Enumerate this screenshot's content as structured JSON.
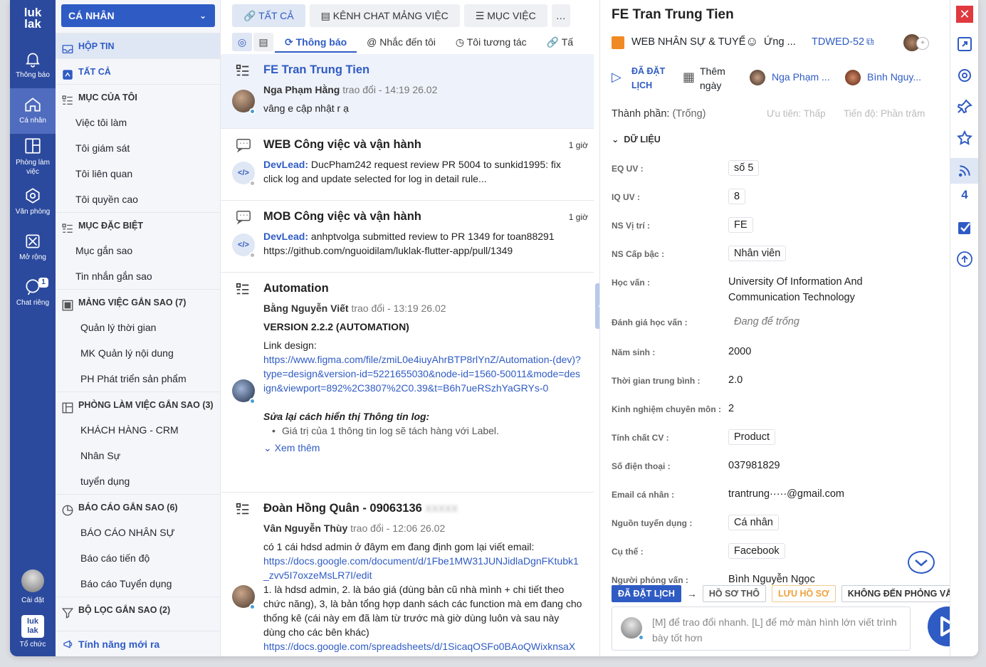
{
  "rail": {
    "logo": "luk lak",
    "items": [
      {
        "label": "Thông báo",
        "icon": "bell-icon"
      },
      {
        "label": "Cá nhân",
        "icon": "home-icon"
      },
      {
        "label": "Phòng làm việc",
        "icon": "layout-icon"
      },
      {
        "label": "Văn phòng",
        "icon": "office-icon"
      },
      {
        "label": "Mở rộng",
        "icon": "extend-icon"
      },
      {
        "label": "Chat riêng",
        "icon": "chat-icon",
        "badge": "1"
      }
    ],
    "settings": "Cài đặt",
    "org": "Tổ chức"
  },
  "sidebar": {
    "header": "CÁ NHÂN",
    "items": [
      {
        "label": "HỘP TIN",
        "type": "head",
        "selected": true
      },
      {
        "label": "TẤT CẢ",
        "type": "head"
      },
      {
        "label": "MỤC CỦA TÔI",
        "type": "head"
      },
      {
        "label": "Việc tôi làm",
        "type": "sub"
      },
      {
        "label": "Tôi giám sát",
        "type": "sub"
      },
      {
        "label": "Tôi liên quan",
        "type": "sub"
      },
      {
        "label": "Tôi quyền cao",
        "type": "sub"
      },
      {
        "label": "MỤC ĐẶC BIỆT",
        "type": "head"
      },
      {
        "label": "Mục gắn sao",
        "type": "sub"
      },
      {
        "label": "Tin nhắn gắn sao",
        "type": "sub"
      },
      {
        "label": "MẢNG VIỆC GẮN SAO (7)",
        "type": "head"
      },
      {
        "label": "Quản lý thời gian",
        "type": "sub2"
      },
      {
        "label": "MK Quản lý nội dung",
        "type": "sub2"
      },
      {
        "label": "PH Phát triển sản phẩm",
        "type": "sub2"
      },
      {
        "label": "PHÒNG LÀM VIỆC GẮN SAO (3)",
        "type": "head"
      },
      {
        "label": "KHÁCH HÀNG - CRM",
        "type": "sub2"
      },
      {
        "label": "Nhân Sự",
        "type": "sub2"
      },
      {
        "label": "tuyển dụng",
        "type": "sub2"
      },
      {
        "label": "BÁO CÁO GẮN SAO (6)",
        "type": "head"
      },
      {
        "label": "BÁO CÁO NHÂN SỰ",
        "type": "sub2"
      },
      {
        "label": "Báo cáo tiến độ",
        "type": "sub2"
      },
      {
        "label": "Báo cáo Tuyển dụng",
        "type": "sub2"
      },
      {
        "label": "BỘ LỌC GẮN SAO (2)",
        "type": "head"
      }
    ],
    "footer": "Tính năng mới ra"
  },
  "center": {
    "top_tabs": [
      {
        "label": "TẤT CẢ",
        "active": true
      },
      {
        "label": "KÊNH CHAT MẢNG VIỆC"
      },
      {
        "label": "MỤC VIỆC"
      },
      {
        "label": "…"
      }
    ],
    "sub_tabs": [
      {
        "label": "Thông báo",
        "active": true
      },
      {
        "label": "@ Nhắc đến tôi"
      },
      {
        "label": "Tôi tương tác"
      },
      {
        "label": "Tấ"
      }
    ],
    "feed": [
      {
        "title": "FE Tran Trung Tien",
        "author": "Nga Phạm Hằng",
        "verb": "trao đổi",
        "time": "14:19 26.02",
        "text": "vâng e cập nhật r ạ"
      },
      {
        "title": "WEB Công việc và vận hành",
        "age": "1 giờ",
        "source": "DevLead:",
        "text": "DucPham242 request review PR 5004 to sunkid1995: fix click log and update selected for log in detail rule..."
      },
      {
        "title": "MOB Công việc và vận hành",
        "age": "1 giờ",
        "source": "DevLead:",
        "text": "anhptvolga submitted review to PR 1349 for toan88291 https://github.com/nguoidilam/luklak-flutter-app/pull/1349"
      },
      {
        "title": "Automation",
        "author": "Bằng Nguyễn Viết",
        "verb": "trao đổi",
        "time": "13:19 26.02",
        "version": "VERSION 2.2.2 (AUTOMATION)",
        "link_label": "Link design:",
        "link": "https://www.figma.com/file/zmiL0e4iuyAhrBTP8rlYnZ/Automation-(dev)?type=design&version-id=5221655030&node-id=1560-50011&mode=design&viewport=892%2C3807%2C0.39&t=B6h7ueRSzhYaGRYs-0",
        "italic": "Sửa lại cách hiển thị Thông tin log:",
        "bullet": "Giá trị của 1 thông tin log sẽ tách hàng với Label.",
        "more": "Xem thêm"
      },
      {
        "title": "Đoàn Hồng Quân - 09063136",
        "title_blur": "xxxxx",
        "author": "Vân Nguyễn Thùy",
        "verb": "trao đổi",
        "time": "12:06 26.02",
        "text1": "có 1 cái hdsd admin ở đâym em đang định gom lại viết email:",
        "link": "https://docs.google.com/document/d/1Fbe1MW31JUNJidlaDgnFKtubk1_zvv5I7oxzeMsLR7I/edit",
        "text2": "1. là hdsd admin, 2. là báo giá (dùng bản cũ nhà mình + chi tiết theo chức năng), 3, là bản tổng hợp danh sách các function mà em đang cho thống kê (cái này em đã làm từ trước mà giờ dùng luôn và sau này dùng cho các bên khác)",
        "link2": "https://docs.google.com/spreadsheets/d/1SicaqOSFo0BAoQWixknsaX"
      }
    ]
  },
  "detail": {
    "title": "FE Tran Trung Tien",
    "workspace": "WEB NHÂN SỰ & TUYỂ",
    "role": "Ứng ...",
    "code": "TDWED-52",
    "status": "ĐÃ ĐẶT LỊCH",
    "date_label": "Thêm ngày",
    "people": [
      "Nga Phạm ...",
      "Bình Nguy..."
    ],
    "component_label": "Thành phần:",
    "component_value": "(Trống)",
    "priority": "Ưu tiên: Thấp",
    "progress": "Tiến độ: Phần trăm",
    "section": "DỮ LIỆU",
    "fields": [
      {
        "label": "EQ UV :",
        "value": "số 5",
        "box": true
      },
      {
        "label": "IQ UV :",
        "value": "8",
        "box": true
      },
      {
        "label": "NS Vị trí :",
        "value": "FE",
        "box": true
      },
      {
        "label": "NS Cấp bậc :",
        "value": "Nhân viên",
        "box": true
      },
      {
        "label": "Học vấn :",
        "value": "University Of Information And Communication Technology"
      },
      {
        "label": "Đánh giá học vấn :",
        "value": "Đang để trống",
        "empty": true
      },
      {
        "label": "Năm sinh :",
        "value": "2000"
      },
      {
        "label": "Thời gian trung bình :",
        "value": "2.0"
      },
      {
        "label": "Kinh nghiệm chuyên môn :",
        "value": "2"
      },
      {
        "label": "Tính chất CV :",
        "value": "Product",
        "box": true
      },
      {
        "label": "Số điện thoại :",
        "value": "037981829"
      },
      {
        "label": "Email cá nhân :",
        "value": "trantrung·····@gmail.com"
      },
      {
        "label": "Nguồn tuyển dụng :",
        "value": "Cá nhân",
        "box": true
      },
      {
        "label": "Cụ thể :",
        "value": "Facebook",
        "box": true
      },
      {
        "label": "Người phỏng vấn :",
        "value": "Bình Nguyễn Ngọc"
      }
    ],
    "actions": [
      "ĐÃ ĐẶT LỊCH",
      "HỒ SƠ THÔ",
      "LƯU HỒ SƠ",
      "KHÔNG ĐẾN PHỎNG VẤN"
    ],
    "composer_placeholder": "[M] để trao đổi nhanh. [L] để mở màn hình lớn viết trình bày tốt hơn"
  },
  "right_rail": {
    "count": "4"
  },
  "colors": {
    "brand": "#2b4a9e",
    "accent": "#2f5bc4",
    "close": "#e0393e"
  }
}
